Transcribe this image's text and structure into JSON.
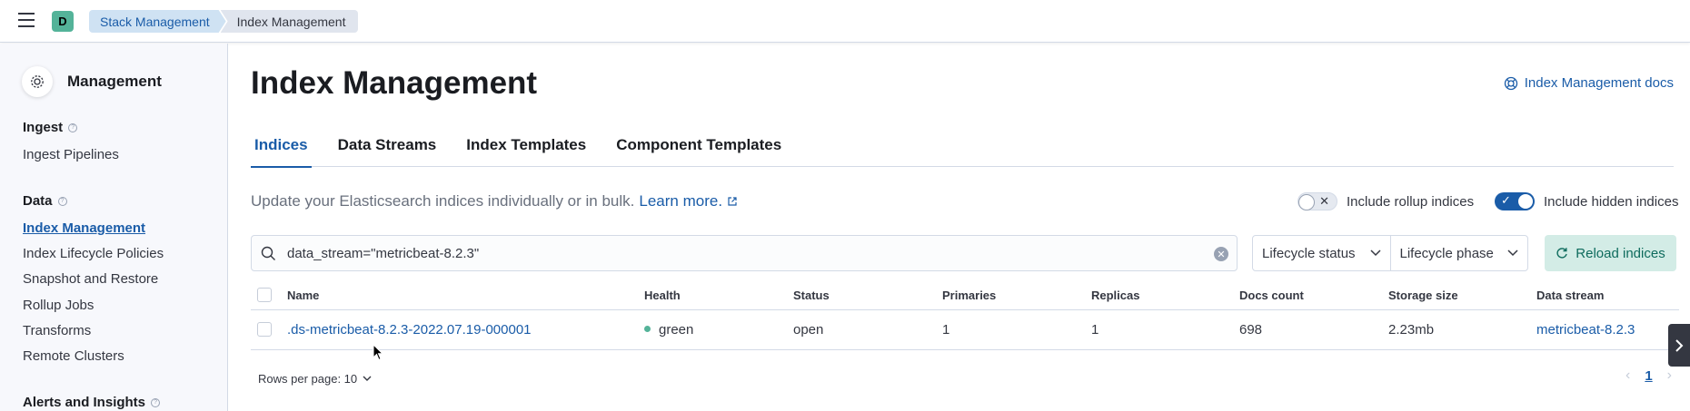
{
  "header": {
    "space_initial": "D",
    "breadcrumbs": [
      "Stack Management",
      "Index Management"
    ]
  },
  "sidebar": {
    "title": "Management",
    "groups": [
      {
        "label": "Ingest",
        "items": [
          "Ingest Pipelines"
        ]
      },
      {
        "label": "Data",
        "items": [
          "Index Management",
          "Index Lifecycle Policies",
          "Snapshot and Restore",
          "Rollup Jobs",
          "Transforms",
          "Remote Clusters"
        ]
      },
      {
        "label": "Alerts and Insights",
        "items": []
      }
    ],
    "active_item": "Index Management"
  },
  "main": {
    "title": "Index Management",
    "docs_link": "Index Management docs",
    "tabs": [
      "Indices",
      "Data Streams",
      "Index Templates",
      "Component Templates"
    ],
    "active_tab": "Indices",
    "description": "Update your Elasticsearch indices individually or in bulk.",
    "learn_more": "Learn more.",
    "toggle_rollup": {
      "label": "Include rollup indices",
      "on": false
    },
    "toggle_hidden": {
      "label": "Include hidden indices",
      "on": true
    },
    "search": {
      "value": "data_stream=\"metricbeat-8.2.3\""
    },
    "filters": [
      "Lifecycle status",
      "Lifecycle phase"
    ],
    "reload_label": "Reload indices",
    "table": {
      "columns": [
        "Name",
        "Health",
        "Status",
        "Primaries",
        "Replicas",
        "Docs count",
        "Storage size",
        "Data stream"
      ],
      "rows": [
        {
          "name": ".ds-metricbeat-8.2.3-2022.07.19-000001",
          "health": "green",
          "status": "open",
          "primaries": "1",
          "replicas": "1",
          "docs_count": "698",
          "storage_size": "2.23mb",
          "data_stream": "metricbeat-8.2.3"
        }
      ]
    },
    "rows_per_page": "Rows per page: 10",
    "current_page": "1"
  },
  "colors": {
    "accent": "#1a5ca8",
    "health_green": "#54b399",
    "avatar": "#54b399"
  }
}
